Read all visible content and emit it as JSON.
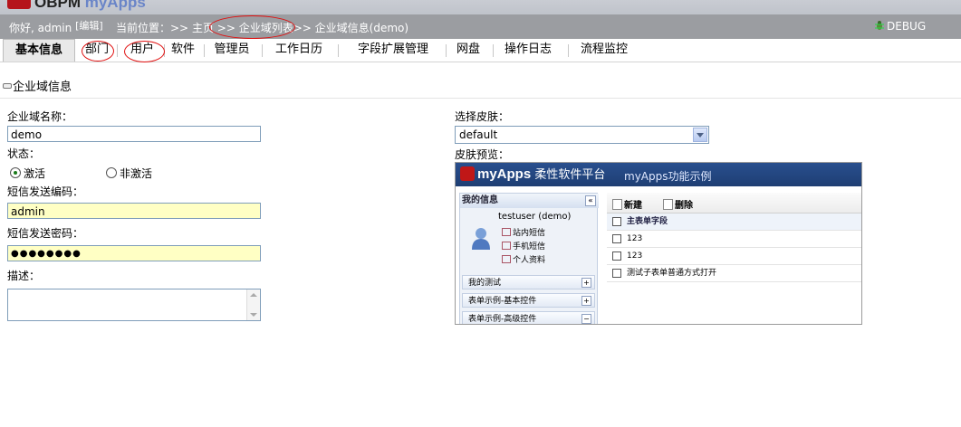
{
  "brand": {
    "title_part1": "OBPM",
    "title_part2": "myApps"
  },
  "status": {
    "greeting": "你好, admin",
    "edit_label": "[编辑]",
    "breadcrumb_prefix": "当前位置：>> ",
    "breadcrumb_home": "主页",
    "breadcrumb_sep1": " >> ",
    "breadcrumb_list": "企业域列表",
    "breadcrumb_sep2": ">> ",
    "breadcrumb_current": "企业域信息(demo)",
    "debug_label": "DEBUG"
  },
  "tabs": [
    "基本信息",
    "部门",
    "用户",
    "软件",
    "管理员",
    "工作日历",
    "字段扩展管理",
    "网盘",
    "操作日志",
    "流程监控"
  ],
  "section": {
    "title": "企业域信息"
  },
  "form": {
    "name_label": "企业域名称：",
    "name_value": "demo",
    "status_label": "状态：",
    "status_active": "激活",
    "status_inactive": "非激活",
    "sms_code_label": "短信发送编码：",
    "sms_code_value": "admin",
    "sms_pwd_label": "短信发送密码：",
    "sms_pwd_value": "●●●●●●●●",
    "desc_label": "描述：",
    "skin_label": "选择皮肤：",
    "skin_value": "default",
    "preview_label": "皮肤预览："
  },
  "preview": {
    "app_name": "myApps",
    "app_cn": "柔性软件平台",
    "subtitle": "myApps功能示例",
    "my_info": "我的信息",
    "user": "testuser (demo)",
    "links": [
      "站内短信",
      "手机短信",
      "个人资料"
    ],
    "menus": [
      "我的测试",
      "表单示例-基本控件",
      "表单示例-高级控件"
    ],
    "toolbar": {
      "new": "新建",
      "delete": "删除"
    },
    "table_header": "主表单字段",
    "rows": [
      "123",
      "123",
      "测试子表单普通方式打开"
    ]
  },
  "colors": {
    "status_bar": "#9b9da1",
    "input_highlight": "#ffffc4",
    "annotation": "#e01010",
    "preview_header": "#294f8e"
  }
}
